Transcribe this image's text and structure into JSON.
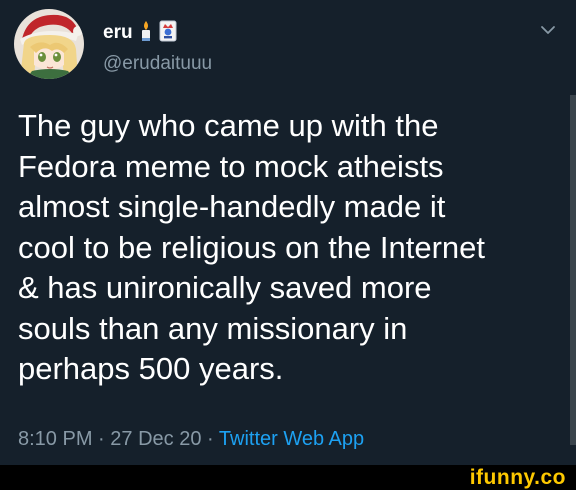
{
  "tweet": {
    "author": {
      "display_name": "eru",
      "handle": "@erudaituuu",
      "name_icons": [
        "candle-emoji-icon",
        "joker-card-emoji-icon"
      ]
    },
    "text_lines": [
      "The guy who came up with the",
      "Fedora meme to mock atheists",
      "almost single-handedly made it",
      "cool to be religious on the Internet",
      "& has unironically saved more",
      "souls than any missionary in",
      "perhaps 500 years."
    ],
    "meta": {
      "time": "8:10 PM",
      "separator": "·",
      "date": "27 Dec 20",
      "source": "Twitter Web App"
    },
    "menu_icon": "chevron-down-icon"
  },
  "watermark": {
    "text": "ifunny.co"
  },
  "colors": {
    "background": "#15202b",
    "text_primary": "#ffffff",
    "text_secondary": "#8899a6",
    "link": "#1da1f2",
    "watermark": "#fdc800"
  }
}
